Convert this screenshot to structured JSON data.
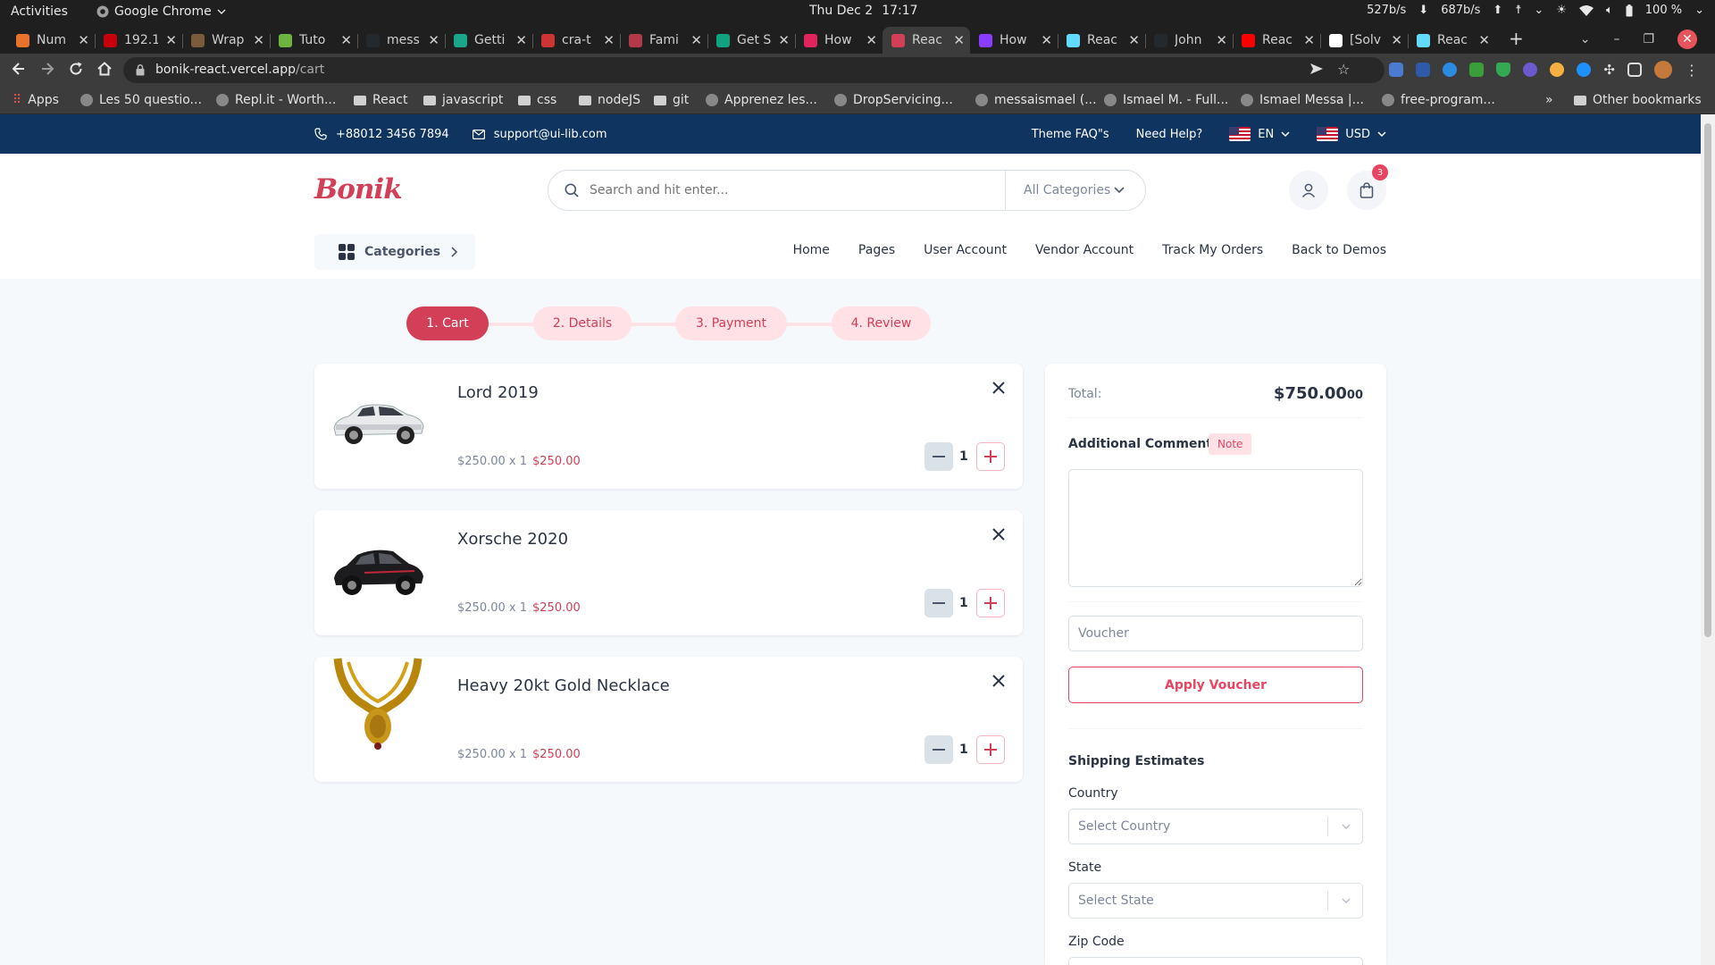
{
  "os": {
    "activities": "Activities",
    "app_name": "Google Chrome",
    "date": "Thu Dec 2",
    "time": "17:17",
    "net_down": "527b/s",
    "net_up": "687b/s",
    "battery": "100 %"
  },
  "browser": {
    "tabs": [
      {
        "title": "Num",
        "color": "#e8732a"
      },
      {
        "title": "192.1",
        "color": "#c7000b"
      },
      {
        "title": "Wrap",
        "color": "#7a5c3a"
      },
      {
        "title": "Tuto",
        "color": "#6db33f"
      },
      {
        "title": "mess",
        "color": "#24292e"
      },
      {
        "title": "Getti",
        "color": "#1aa68a"
      },
      {
        "title": "cra-t",
        "color": "#cc3534"
      },
      {
        "title": "Fami",
        "color": "#b23a48"
      },
      {
        "title": "Get S",
        "color": "#10a37f"
      },
      {
        "title": "How",
        "color": "#e0245e"
      },
      {
        "title": "Reac",
        "color": "#d23f57"
      },
      {
        "title": "How",
        "color": "#8b3dff"
      },
      {
        "title": "Reac",
        "color": "#61dafb"
      },
      {
        "title": "John",
        "color": "#24292e"
      },
      {
        "title": "Reac",
        "color": "#ff0000"
      },
      {
        "title": "[Solv",
        "color": "#ffffff"
      },
      {
        "title": "Reac",
        "color": "#61dafb"
      }
    ],
    "url_domain": "bonik-react.vercel.app",
    "url_path": "/cart",
    "bookmarks": [
      {
        "label": "Apps",
        "type": "apps"
      },
      {
        "label": "Les 50 questio...",
        "type": "site"
      },
      {
        "label": "Repl.it - Worth...",
        "type": "site"
      },
      {
        "label": "React",
        "type": "folder"
      },
      {
        "label": "javascript",
        "type": "folder"
      },
      {
        "label": "css",
        "type": "folder"
      },
      {
        "label": "nodeJS",
        "type": "folder"
      },
      {
        "label": "git",
        "type": "folder"
      },
      {
        "label": "Apprenez les...",
        "type": "site"
      },
      {
        "label": "DropServicing...",
        "type": "site"
      },
      {
        "label": "messaismael (...",
        "type": "site"
      },
      {
        "label": "Ismael M. - Full...",
        "type": "site"
      },
      {
        "label": "Ismael Messa |...",
        "type": "site"
      },
      {
        "label": "free-program...",
        "type": "site"
      }
    ],
    "bookmarks_overflow": "»",
    "other_bookmarks": "Other bookmarks"
  },
  "topbar": {
    "phone": "+88012 3456 7894",
    "email": "support@ui-lib.com",
    "theme_faq": "Theme FAQ\"s",
    "need_help": "Need Help?",
    "language": "EN",
    "currency": "USD"
  },
  "header": {
    "logo": "Bonik",
    "search_placeholder": "Search and hit enter...",
    "category_select": "All Categories",
    "cart_count": "3",
    "categories_button": "Categories",
    "nav": [
      "Home",
      "Pages",
      "User Account",
      "Vendor Account",
      "Track My Orders",
      "Back to Demos"
    ]
  },
  "steps": [
    "1. Cart",
    "2. Details",
    "3. Payment",
    "4. Review"
  ],
  "cart_items": [
    {
      "name": "Lord 2019",
      "unit_price": "$250.00 x 1",
      "total": "$250.00",
      "qty": "1",
      "image": "white-suv-icon"
    },
    {
      "name": "Xorsche 2020",
      "unit_price": "$250.00 x 1",
      "total": "$250.00",
      "qty": "1",
      "image": "black-hatchback-icon"
    },
    {
      "name": "Heavy 20kt Gold Necklace",
      "unit_price": "$250.00 x 1",
      "total": "$250.00",
      "qty": "1",
      "image": "gold-necklace-icon"
    }
  ],
  "summary": {
    "total_label": "Total:",
    "total_value": "$750.00",
    "total_cents": "00",
    "comments_label": "Additional Comments",
    "note_badge": "Note",
    "voucher_placeholder": "Voucher",
    "apply_voucher": "Apply Voucher",
    "shipping_title": "Shipping Estimates",
    "country_label": "Country",
    "country_placeholder": "Select Country",
    "state_label": "State",
    "state_placeholder": "Select State",
    "zip_label": "Zip Code"
  },
  "colors": {
    "primary": "#d23f57",
    "topbar_bg": "#0f3460",
    "accent_light": "#ffe1e6"
  }
}
